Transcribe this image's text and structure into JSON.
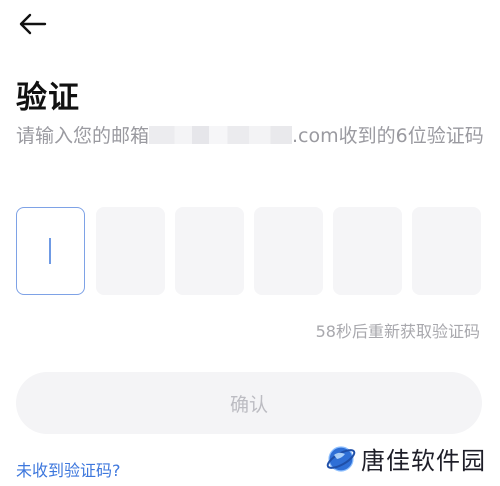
{
  "header": {
    "back_icon": "arrow-left-icon"
  },
  "main": {
    "title": "验证",
    "description_prefix": "请输入您的邮箱",
    "description_suffix": ".com收到的6位验证码",
    "code_boxes": [
      "",
      "",
      "",
      "",
      "",
      ""
    ],
    "resend_text": "58秒后重新获取验证码",
    "confirm_label": "确认",
    "no_code_link": "未收到验证码?"
  },
  "watermark": {
    "text": "唐佳软件园",
    "logo_icon": "globe-logo-icon"
  },
  "colors": {
    "accent": "#3d77dd",
    "active_border": "#7ea2e6",
    "box_bg": "#f5f5f7",
    "muted_text": "#9a9aa0"
  }
}
